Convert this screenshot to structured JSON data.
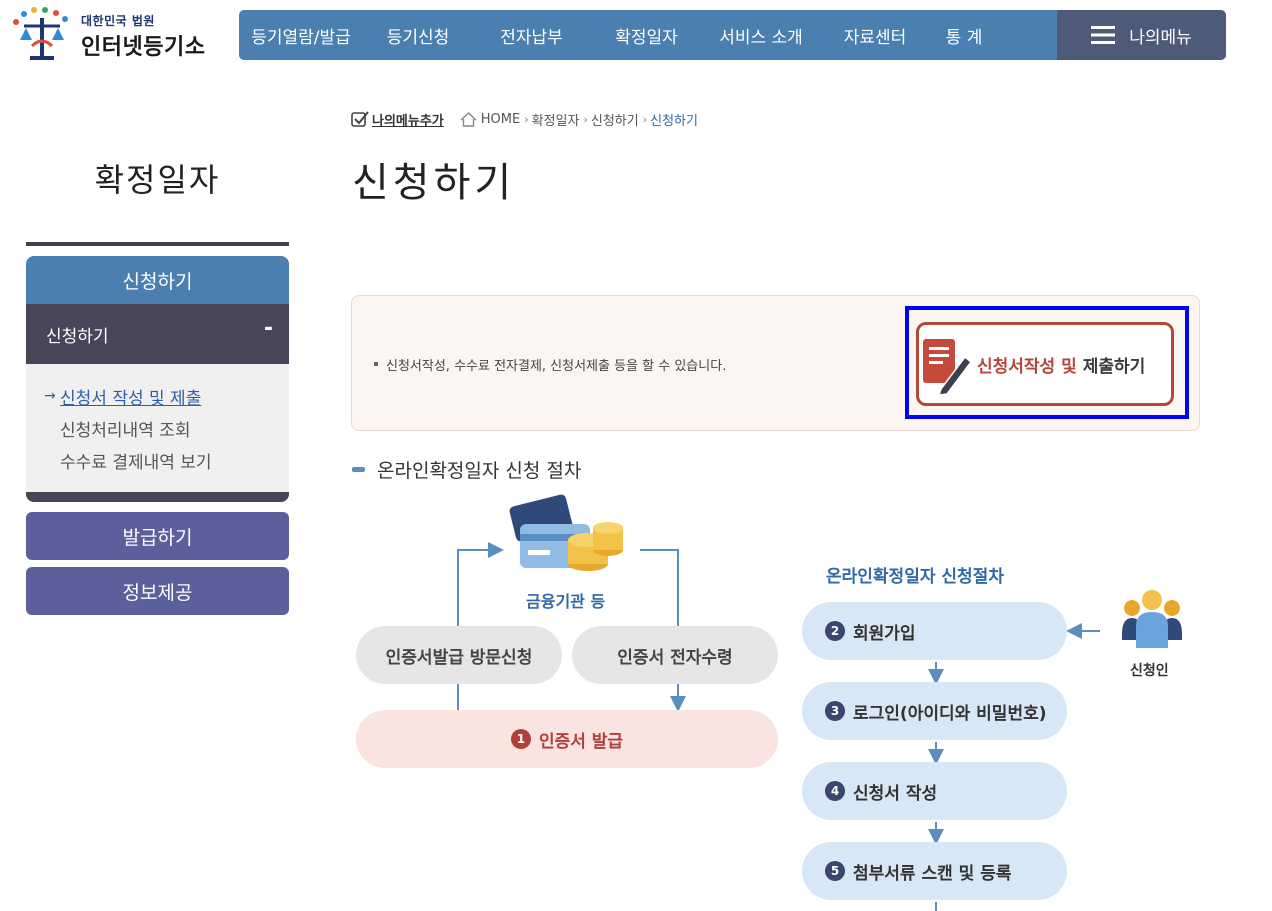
{
  "logo": {
    "line1": "대한민국 법원",
    "line2": "인터넷등기소"
  },
  "gnb": {
    "items": [
      "등기열람/발급",
      "등기신청",
      "전자납부",
      "확정일자",
      "서비스 소개",
      "자료센터",
      "통 계"
    ],
    "my_menu": "나의메뉴"
  },
  "breadcrumb": {
    "add_label": "나의메뉴추가",
    "items": [
      "HOME",
      "확정일자",
      "신청하기",
      "신청하기"
    ]
  },
  "page_title": "신청하기",
  "side_title": "확정일자",
  "lnb": {
    "head": "신청하기",
    "sub": "신청하기",
    "toggle": "-",
    "arrow": "→",
    "items": [
      "신청서 작성 및 제출",
      "신청처리내역 조회",
      "수수료 결제내역 보기"
    ],
    "btn_issue": "발급하기",
    "btn_info": "정보제공"
  },
  "info": {
    "text": "신청서작성, 수수료 전자결제, 신청서제출 등을 할 수 있습니다.",
    "btn_part1": "신청서작성 및",
    "btn_part2": "제출하기"
  },
  "process": {
    "section_title": "온라인확정일자 신청 절차",
    "bank_label": "금융기관 등",
    "visit": "인증서발급 방문신청",
    "electronic": "인증서 전자수령",
    "cert_num": "1",
    "cert": "인증서 발급",
    "right_title": "온라인확정일자 신청절차",
    "applicant": "신청인",
    "steps": [
      {
        "num": "2",
        "label": "회원가입"
      },
      {
        "num": "3",
        "label": "로그인(아이디와 비밀번호)"
      },
      {
        "num": "4",
        "label": "신청서 작성"
      },
      {
        "num": "5",
        "label": "첨부서류 스캔 및 등록"
      }
    ]
  },
  "colors": {
    "nav_blue": "#4a7fb0",
    "nav_dark": "#4d5a78",
    "lnb_purple": "#5b5f9c",
    "accent_red": "#b5433c",
    "highlight_blue": "#0000ff"
  }
}
